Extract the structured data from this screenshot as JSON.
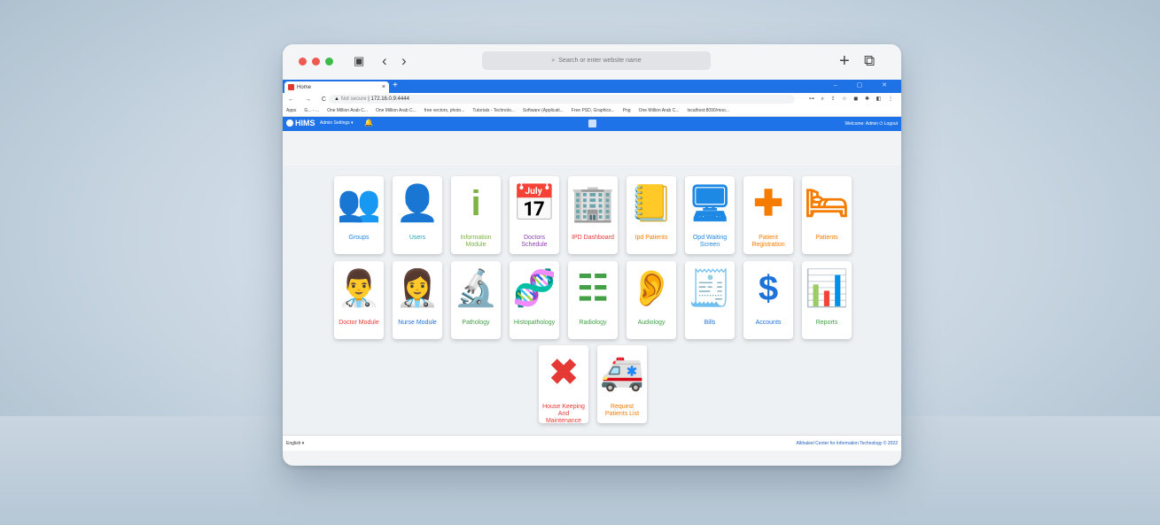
{
  "safari": {
    "address_placeholder": "Search or enter website name",
    "back_icon": "‹",
    "forward_icon": "›",
    "plus_icon": "+",
    "tabs_icon": "⧉"
  },
  "browser": {
    "tab_title": "Home",
    "tab_close": "×",
    "new_tab": "+",
    "url_security": "Not secure",
    "url": "172.16.0.9:4444",
    "bookmarks": [
      "Apps",
      "G... - ...",
      "One Million Arab C...",
      "One Million Arab C...",
      "free vectors, photo...",
      "Tutorials - Technolo...",
      "Software (Applicati...",
      "Free PSD, Graphics...",
      "Png",
      "One Million Arab C...",
      "localhost:8090/moo..."
    ]
  },
  "app": {
    "brand": "HIMS",
    "admin_settings": "Admin Settings ▾",
    "welcome": "Welcome: Admin ⏻ Logout",
    "footer_lang": "English ▾",
    "footer_copy": "Alkhaleel Center for Information Technology © 2022"
  },
  "modules": [
    {
      "label": "Groups",
      "icon": "users-group-icon",
      "glyph": "👥",
      "color": "#1e88e5"
    },
    {
      "label": "Users",
      "icon": "user-icon",
      "glyph": "👤",
      "color": "#26a6b8"
    },
    {
      "label": "Information Module",
      "icon": "info-icon",
      "glyph": "i",
      "color": "#7cb342"
    },
    {
      "label": "Doctors Schedule",
      "icon": "calendar-icon",
      "glyph": "📅",
      "color": "#8e44ad"
    },
    {
      "label": "IPD Dashboard",
      "icon": "hospital-building-icon",
      "glyph": "🏢",
      "color": "#e53935"
    },
    {
      "label": "Ipd Patients",
      "icon": "contact-book-icon",
      "glyph": "📒",
      "color": "#f57c00"
    },
    {
      "label": "Opd Waiting Screen",
      "icon": "screen-teacher-icon",
      "glyph": "🖥",
      "color": "#1e88e5"
    },
    {
      "label": "Patient Registration",
      "icon": "medical-plus-icon",
      "glyph": "✚",
      "color": "#f57c00"
    },
    {
      "label": "Patients",
      "icon": "hospital-bed-icon",
      "glyph": "🛏",
      "color": "#f57c00"
    },
    {
      "label": "Doctor Module",
      "icon": "doctor-icon",
      "glyph": "👨‍⚕",
      "color": "#e53935"
    },
    {
      "label": "Nurse Module",
      "icon": "nurse-icon",
      "glyph": "👩‍⚕",
      "color": "#1e73d8"
    },
    {
      "label": "Pathology",
      "icon": "microscope-icon",
      "glyph": "🔬",
      "color": "#43a047"
    },
    {
      "label": "Histopathology",
      "icon": "dna-icon",
      "glyph": "🧬",
      "color": "#43a047"
    },
    {
      "label": "Radiology",
      "icon": "xray-icon",
      "glyph": "☷",
      "color": "#43a047"
    },
    {
      "label": "Audiology",
      "icon": "ear-icon",
      "glyph": "👂",
      "color": "#43a047"
    },
    {
      "label": "Bills",
      "icon": "invoice-icon",
      "glyph": "🧾",
      "color": "#1e73d8"
    },
    {
      "label": "Accounts",
      "icon": "money-hand-icon",
      "glyph": "$",
      "color": "#1e73d8"
    },
    {
      "label": "Reports",
      "icon": "bar-chart-icon",
      "glyph": "📊",
      "color": "#43a047"
    },
    {
      "label": "House Keeping And Maintenance",
      "icon": "tools-icon",
      "glyph": "✖",
      "color": "#e53935"
    },
    {
      "label": "Request Patients List",
      "icon": "ambulance-icon",
      "glyph": "🚑",
      "color": "#f57c00"
    }
  ]
}
